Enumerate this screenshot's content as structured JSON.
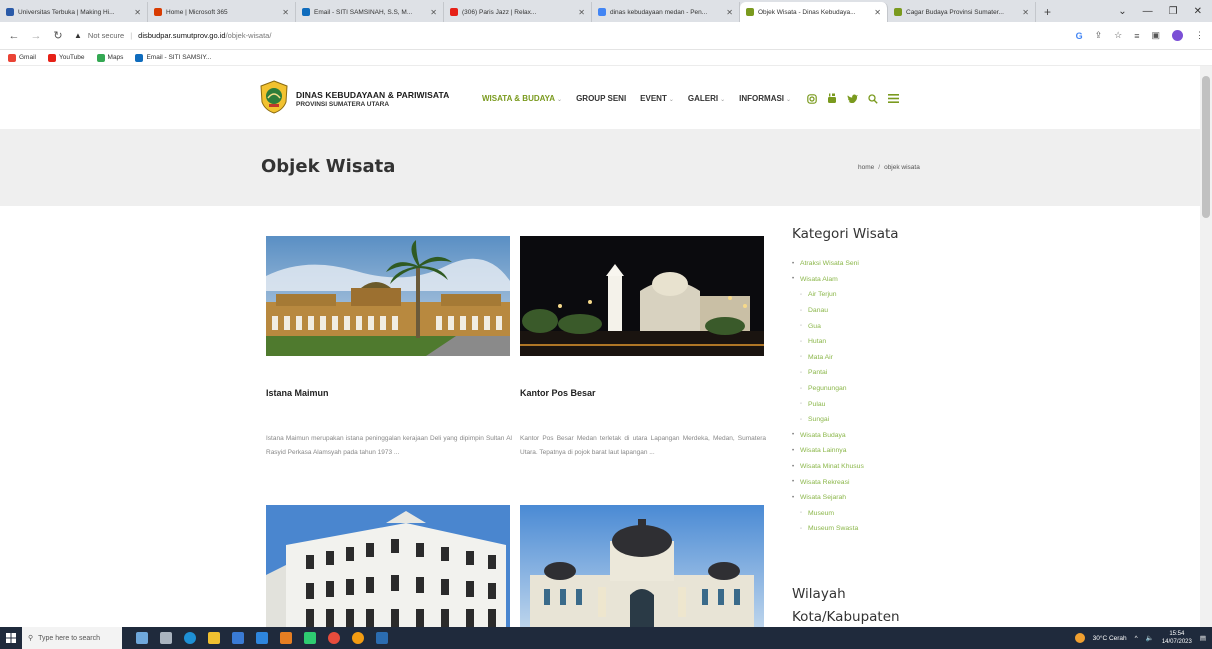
{
  "browser": {
    "tabs": [
      {
        "title": "Universitas Terbuka | Making Hi...",
        "color": "#2a5aa8",
        "active": false
      },
      {
        "title": "Home | Microsoft 365",
        "color": "#d83b01",
        "active": false
      },
      {
        "title": "Email - SITI SAMSINAH, S.S, M...",
        "color": "#0f6cbd",
        "active": false
      },
      {
        "title": "(306) Paris Jazz | Relax...",
        "color": "#e62117",
        "active": false
      },
      {
        "title": "dinas kebudayaan medan - Pen...",
        "color": "#4285f4",
        "active": false
      },
      {
        "title": "Objek Wisata - Dinas Kebudaya...",
        "color": "#7a9a1e",
        "active": true
      },
      {
        "title": "Cagar Budaya Provinsi Sumater...",
        "color": "#7a9a1e",
        "active": false
      }
    ],
    "new_tab": "+",
    "security": "Not secure",
    "url_domain": "disbudpar.sumutprov.go.id",
    "url_path": "/objek-wisata/",
    "bookmarks": [
      {
        "label": "Gmail",
        "color": "#ea4335"
      },
      {
        "label": "YouTube",
        "color": "#e62117"
      },
      {
        "label": "Maps",
        "color": "#34a853"
      },
      {
        "label": "Email - SITI SAMSIY...",
        "color": "#0f6cbd"
      }
    ]
  },
  "site": {
    "brand_line1": "DINAS KEBUDAYAAN & PARIWISATA",
    "brand_line2": "PROVINSI SUMATERA UTARA",
    "nav": [
      {
        "label": "WISATA & BUDAYA",
        "dropdown": true,
        "active": true
      },
      {
        "label": "GROUP SENI",
        "dropdown": false,
        "active": false
      },
      {
        "label": "EVENT",
        "dropdown": true,
        "active": false
      },
      {
        "label": "GALERI",
        "dropdown": true,
        "active": false
      },
      {
        "label": "INFORMASI",
        "dropdown": true,
        "active": false
      }
    ],
    "accent_color": "#7a9a1e",
    "link_color": "#8bb74a"
  },
  "page": {
    "title": "Objek Wisata",
    "breadcrumb": {
      "home": "home",
      "sep": "/",
      "current": "objek wisata"
    }
  },
  "cards": [
    {
      "title": "Istana Maimun",
      "text": "Istana Maimun merupakan istana peninggalan kerajaan Deli yang dipimpin Sultan Al Rasyid Perkasa Alamsyah pada tahun 1973 ..."
    },
    {
      "title": "Kantor Pos Besar",
      "text": "Kantor Pos Besar Medan terletak di utara Lapangan Merdeka, Medan, Sumatera Utara. Tepatnya di pojok barat laut lapangan ..."
    }
  ],
  "sidebar": {
    "categories_heading": "Kategori Wisata",
    "categories": [
      {
        "label": "Atraksi Wisata Seni",
        "sub": false
      },
      {
        "label": "Wisata Alam",
        "sub": false
      },
      {
        "label": "Air Terjun",
        "sub": true
      },
      {
        "label": "Danau",
        "sub": true
      },
      {
        "label": "Gua",
        "sub": true
      },
      {
        "label": "Hutan",
        "sub": true
      },
      {
        "label": "Mata Air",
        "sub": true
      },
      {
        "label": "Pantai",
        "sub": true
      },
      {
        "label": "Pegunungan",
        "sub": true
      },
      {
        "label": "Pulau",
        "sub": true
      },
      {
        "label": "Sungai",
        "sub": true
      },
      {
        "label": "Wisata Budaya",
        "sub": false
      },
      {
        "label": "Wisata Lainnya",
        "sub": false
      },
      {
        "label": "Wisata Minat Khusus",
        "sub": false
      },
      {
        "label": "Wisata Rekreasi",
        "sub": false
      },
      {
        "label": "Wisata Sejarah",
        "sub": false
      },
      {
        "label": "Museum",
        "sub": true
      },
      {
        "label": "Museum Swasta",
        "sub": true
      }
    ],
    "region_heading_line1": "Wilayah",
    "region_heading_line2": "Kota/Kabupaten"
  },
  "taskbar": {
    "search_placeholder": "Type here to search",
    "weather": "30°C Cerah",
    "time": "15:54",
    "date": "14/07/2023"
  }
}
